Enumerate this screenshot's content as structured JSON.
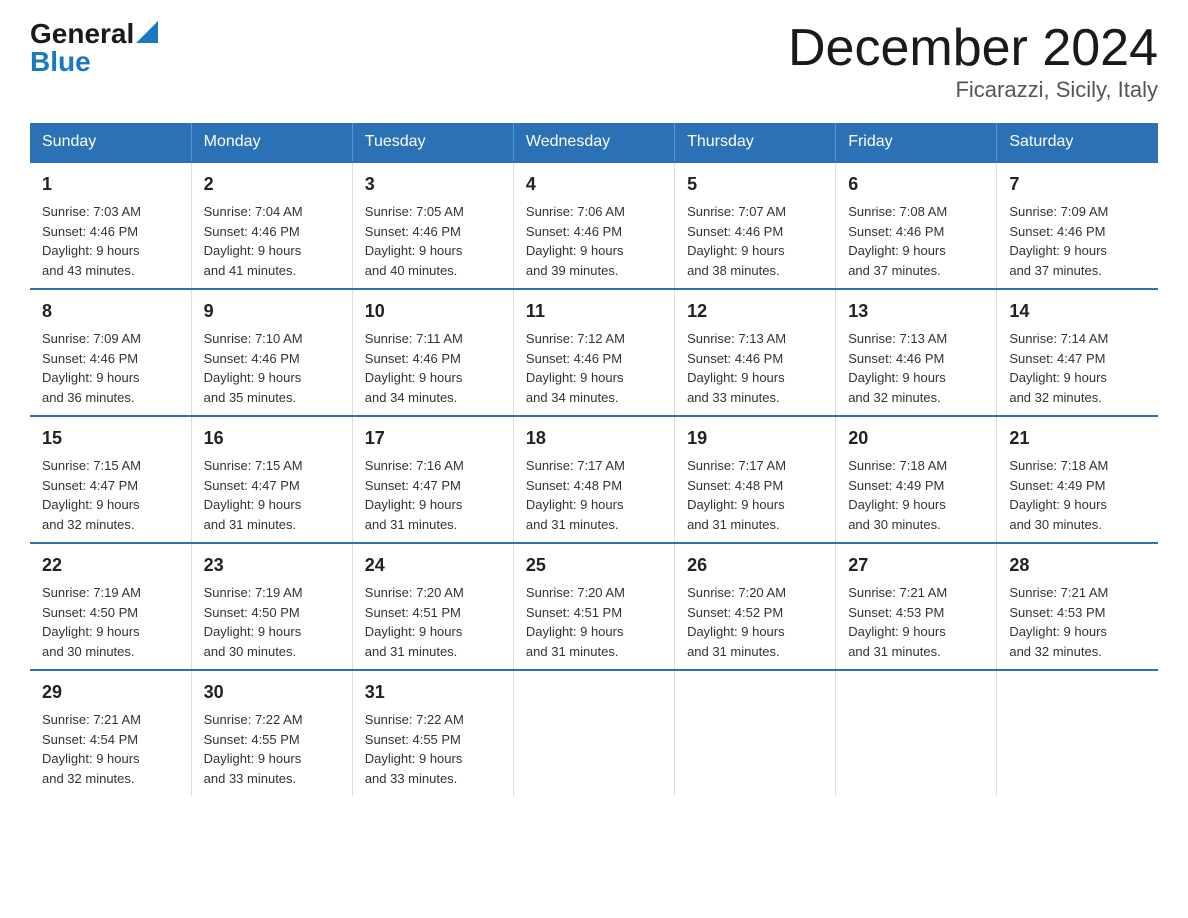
{
  "header": {
    "logo_general": "General",
    "logo_blue": "Blue",
    "month_title": "December 2024",
    "location": "Ficarazzi, Sicily, Italy"
  },
  "weekdays": [
    "Sunday",
    "Monday",
    "Tuesday",
    "Wednesday",
    "Thursday",
    "Friday",
    "Saturday"
  ],
  "weeks": [
    [
      {
        "day": "1",
        "sunrise": "7:03 AM",
        "sunset": "4:46 PM",
        "daylight": "9 hours and 43 minutes."
      },
      {
        "day": "2",
        "sunrise": "7:04 AM",
        "sunset": "4:46 PM",
        "daylight": "9 hours and 41 minutes."
      },
      {
        "day": "3",
        "sunrise": "7:05 AM",
        "sunset": "4:46 PM",
        "daylight": "9 hours and 40 minutes."
      },
      {
        "day": "4",
        "sunrise": "7:06 AM",
        "sunset": "4:46 PM",
        "daylight": "9 hours and 39 minutes."
      },
      {
        "day": "5",
        "sunrise": "7:07 AM",
        "sunset": "4:46 PM",
        "daylight": "9 hours and 38 minutes."
      },
      {
        "day": "6",
        "sunrise": "7:08 AM",
        "sunset": "4:46 PM",
        "daylight": "9 hours and 37 minutes."
      },
      {
        "day": "7",
        "sunrise": "7:09 AM",
        "sunset": "4:46 PM",
        "daylight": "9 hours and 37 minutes."
      }
    ],
    [
      {
        "day": "8",
        "sunrise": "7:09 AM",
        "sunset": "4:46 PM",
        "daylight": "9 hours and 36 minutes."
      },
      {
        "day": "9",
        "sunrise": "7:10 AM",
        "sunset": "4:46 PM",
        "daylight": "9 hours and 35 minutes."
      },
      {
        "day": "10",
        "sunrise": "7:11 AM",
        "sunset": "4:46 PM",
        "daylight": "9 hours and 34 minutes."
      },
      {
        "day": "11",
        "sunrise": "7:12 AM",
        "sunset": "4:46 PM",
        "daylight": "9 hours and 34 minutes."
      },
      {
        "day": "12",
        "sunrise": "7:13 AM",
        "sunset": "4:46 PM",
        "daylight": "9 hours and 33 minutes."
      },
      {
        "day": "13",
        "sunrise": "7:13 AM",
        "sunset": "4:46 PM",
        "daylight": "9 hours and 32 minutes."
      },
      {
        "day": "14",
        "sunrise": "7:14 AM",
        "sunset": "4:47 PM",
        "daylight": "9 hours and 32 minutes."
      }
    ],
    [
      {
        "day": "15",
        "sunrise": "7:15 AM",
        "sunset": "4:47 PM",
        "daylight": "9 hours and 32 minutes."
      },
      {
        "day": "16",
        "sunrise": "7:15 AM",
        "sunset": "4:47 PM",
        "daylight": "9 hours and 31 minutes."
      },
      {
        "day": "17",
        "sunrise": "7:16 AM",
        "sunset": "4:47 PM",
        "daylight": "9 hours and 31 minutes."
      },
      {
        "day": "18",
        "sunrise": "7:17 AM",
        "sunset": "4:48 PM",
        "daylight": "9 hours and 31 minutes."
      },
      {
        "day": "19",
        "sunrise": "7:17 AM",
        "sunset": "4:48 PM",
        "daylight": "9 hours and 31 minutes."
      },
      {
        "day": "20",
        "sunrise": "7:18 AM",
        "sunset": "4:49 PM",
        "daylight": "9 hours and 30 minutes."
      },
      {
        "day": "21",
        "sunrise": "7:18 AM",
        "sunset": "4:49 PM",
        "daylight": "9 hours and 30 minutes."
      }
    ],
    [
      {
        "day": "22",
        "sunrise": "7:19 AM",
        "sunset": "4:50 PM",
        "daylight": "9 hours and 30 minutes."
      },
      {
        "day": "23",
        "sunrise": "7:19 AM",
        "sunset": "4:50 PM",
        "daylight": "9 hours and 30 minutes."
      },
      {
        "day": "24",
        "sunrise": "7:20 AM",
        "sunset": "4:51 PM",
        "daylight": "9 hours and 31 minutes."
      },
      {
        "day": "25",
        "sunrise": "7:20 AM",
        "sunset": "4:51 PM",
        "daylight": "9 hours and 31 minutes."
      },
      {
        "day": "26",
        "sunrise": "7:20 AM",
        "sunset": "4:52 PM",
        "daylight": "9 hours and 31 minutes."
      },
      {
        "day": "27",
        "sunrise": "7:21 AM",
        "sunset": "4:53 PM",
        "daylight": "9 hours and 31 minutes."
      },
      {
        "day": "28",
        "sunrise": "7:21 AM",
        "sunset": "4:53 PM",
        "daylight": "9 hours and 32 minutes."
      }
    ],
    [
      {
        "day": "29",
        "sunrise": "7:21 AM",
        "sunset": "4:54 PM",
        "daylight": "9 hours and 32 minutes."
      },
      {
        "day": "30",
        "sunrise": "7:22 AM",
        "sunset": "4:55 PM",
        "daylight": "9 hours and 33 minutes."
      },
      {
        "day": "31",
        "sunrise": "7:22 AM",
        "sunset": "4:55 PM",
        "daylight": "9 hours and 33 minutes."
      },
      null,
      null,
      null,
      null
    ]
  ],
  "labels": {
    "sunrise": "Sunrise:",
    "sunset": "Sunset:",
    "daylight": "Daylight:"
  }
}
